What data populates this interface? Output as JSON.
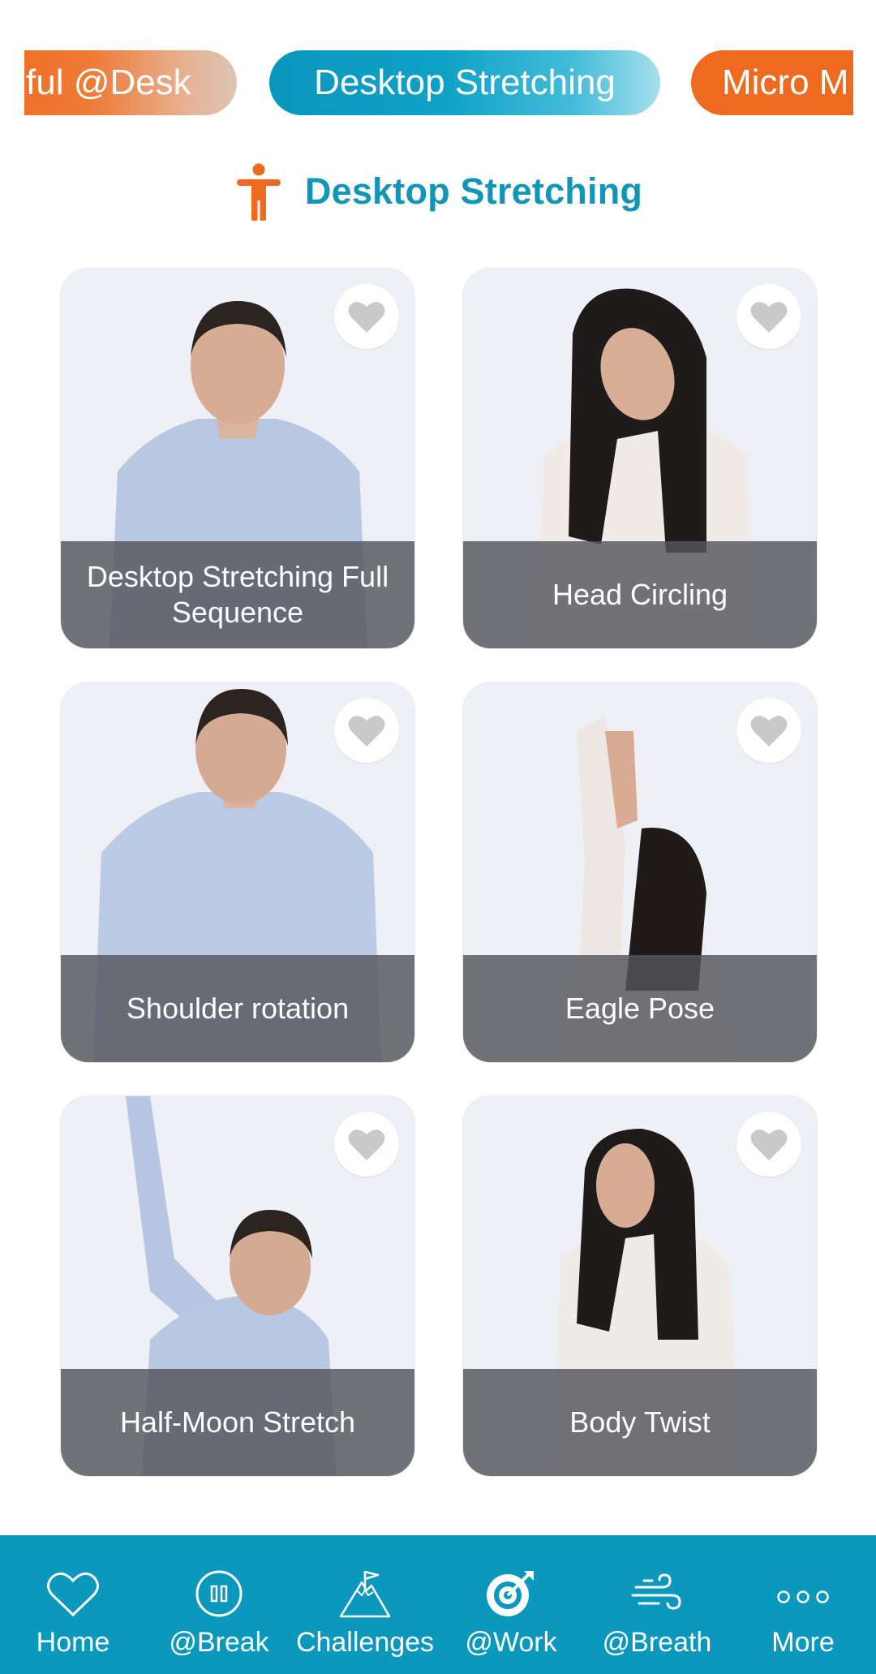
{
  "categories": {
    "left": "ful @Desk",
    "active": "Desktop Stretching",
    "right": "Micro M"
  },
  "section": {
    "title": "Desktop Stretching",
    "icon": "standing-person-icon"
  },
  "cards": [
    {
      "label": "Desktop Stretching Full Sequence",
      "favorite_icon": "heart-icon"
    },
    {
      "label": "Head Circling",
      "favorite_icon": "heart-icon"
    },
    {
      "label": "Shoulder rotation",
      "favorite_icon": "heart-icon"
    },
    {
      "label": "Eagle Pose",
      "favorite_icon": "heart-icon"
    },
    {
      "label": "Half-Moon Stretch",
      "favorite_icon": "heart-icon"
    },
    {
      "label": "Body Twist",
      "favorite_icon": "heart-icon"
    }
  ],
  "tabbar": {
    "selected": "@Work",
    "items": [
      {
        "label": "Home",
        "icon": "heart-outline-icon"
      },
      {
        "label": "@Break",
        "icon": "pause-circle-icon"
      },
      {
        "label": "Challenges",
        "icon": "mountain-flag-icon"
      },
      {
        "label": "@Work",
        "icon": "target-arrow-icon"
      },
      {
        "label": "@Breath",
        "icon": "wind-icon"
      },
      {
        "label": "More",
        "icon": "more-dots-icon"
      }
    ]
  },
  "colors": {
    "accent_blue": "#0a98bd",
    "accent_orange": "#ee6a1f",
    "title_blue": "#1196b8",
    "favorite_heart": "#c9c9c9"
  }
}
